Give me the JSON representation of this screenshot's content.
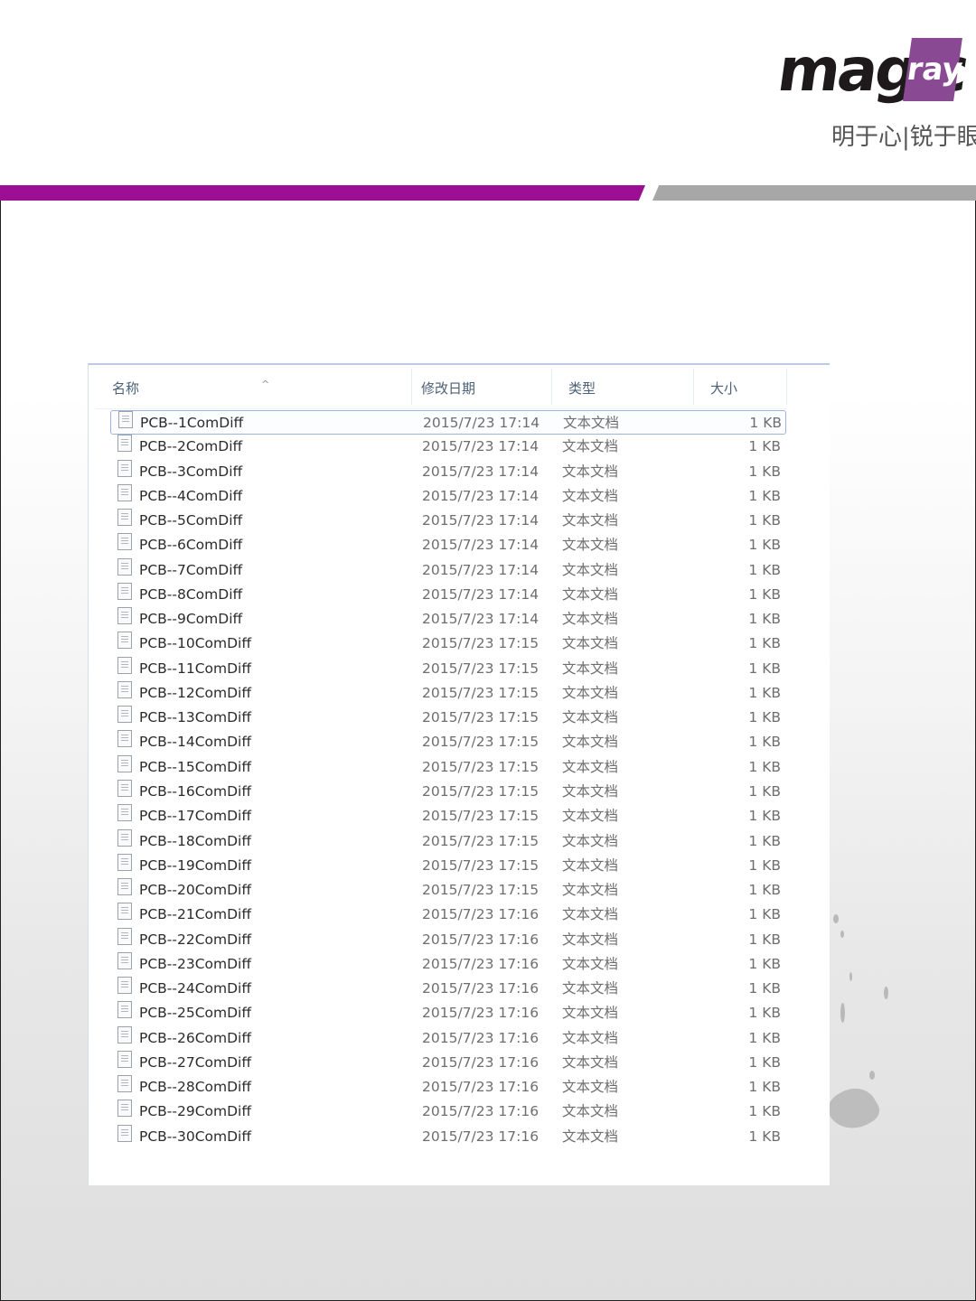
{
  "brand": {
    "logo_main": "magic",
    "logo_accent": "ray",
    "slogan": "明于心|锐于眼",
    "colors": {
      "purple_band": "#9c0f94",
      "gray_band": "#a7a7a7",
      "logo_accent_bg": "#8a4a93"
    }
  },
  "explorer": {
    "columns": {
      "name": "名称",
      "date": "修改日期",
      "type": "类型",
      "size": "大小"
    },
    "sort_indicator": "^",
    "files": [
      {
        "name": "PCB--1ComDiff",
        "date": "2015/7/23 17:14",
        "type": "文本文档",
        "size": "1 KB"
      },
      {
        "name": "PCB--2ComDiff",
        "date": "2015/7/23 17:14",
        "type": "文本文档",
        "size": "1 KB"
      },
      {
        "name": "PCB--3ComDiff",
        "date": "2015/7/23 17:14",
        "type": "文本文档",
        "size": "1 KB"
      },
      {
        "name": "PCB--4ComDiff",
        "date": "2015/7/23 17:14",
        "type": "文本文档",
        "size": "1 KB"
      },
      {
        "name": "PCB--5ComDiff",
        "date": "2015/7/23 17:14",
        "type": "文本文档",
        "size": "1 KB"
      },
      {
        "name": "PCB--6ComDiff",
        "date": "2015/7/23 17:14",
        "type": "文本文档",
        "size": "1 KB"
      },
      {
        "name": "PCB--7ComDiff",
        "date": "2015/7/23 17:14",
        "type": "文本文档",
        "size": "1 KB"
      },
      {
        "name": "PCB--8ComDiff",
        "date": "2015/7/23 17:14",
        "type": "文本文档",
        "size": "1 KB"
      },
      {
        "name": "PCB--9ComDiff",
        "date": "2015/7/23 17:14",
        "type": "文本文档",
        "size": "1 KB"
      },
      {
        "name": "PCB--10ComDiff",
        "date": "2015/7/23 17:15",
        "type": "文本文档",
        "size": "1 KB"
      },
      {
        "name": "PCB--11ComDiff",
        "date": "2015/7/23 17:15",
        "type": "文本文档",
        "size": "1 KB"
      },
      {
        "name": "PCB--12ComDiff",
        "date": "2015/7/23 17:15",
        "type": "文本文档",
        "size": "1 KB"
      },
      {
        "name": "PCB--13ComDiff",
        "date": "2015/7/23 17:15",
        "type": "文本文档",
        "size": "1 KB"
      },
      {
        "name": "PCB--14ComDiff",
        "date": "2015/7/23 17:15",
        "type": "文本文档",
        "size": "1 KB"
      },
      {
        "name": "PCB--15ComDiff",
        "date": "2015/7/23 17:15",
        "type": "文本文档",
        "size": "1 KB"
      },
      {
        "name": "PCB--16ComDiff",
        "date": "2015/7/23 17:15",
        "type": "文本文档",
        "size": "1 KB"
      },
      {
        "name": "PCB--17ComDiff",
        "date": "2015/7/23 17:15",
        "type": "文本文档",
        "size": "1 KB"
      },
      {
        "name": "PCB--18ComDiff",
        "date": "2015/7/23 17:15",
        "type": "文本文档",
        "size": "1 KB"
      },
      {
        "name": "PCB--19ComDiff",
        "date": "2015/7/23 17:15",
        "type": "文本文档",
        "size": "1 KB"
      },
      {
        "name": "PCB--20ComDiff",
        "date": "2015/7/23 17:15",
        "type": "文本文档",
        "size": "1 KB"
      },
      {
        "name": "PCB--21ComDiff",
        "date": "2015/7/23 17:16",
        "type": "文本文档",
        "size": "1 KB"
      },
      {
        "name": "PCB--22ComDiff",
        "date": "2015/7/23 17:16",
        "type": "文本文档",
        "size": "1 KB"
      },
      {
        "name": "PCB--23ComDiff",
        "date": "2015/7/23 17:16",
        "type": "文本文档",
        "size": "1 KB"
      },
      {
        "name": "PCB--24ComDiff",
        "date": "2015/7/23 17:16",
        "type": "文本文档",
        "size": "1 KB"
      },
      {
        "name": "PCB--25ComDiff",
        "date": "2015/7/23 17:16",
        "type": "文本文档",
        "size": "1 KB"
      },
      {
        "name": "PCB--26ComDiff",
        "date": "2015/7/23 17:16",
        "type": "文本文档",
        "size": "1 KB"
      },
      {
        "name": "PCB--27ComDiff",
        "date": "2015/7/23 17:16",
        "type": "文本文档",
        "size": "1 KB"
      },
      {
        "name": "PCB--28ComDiff",
        "date": "2015/7/23 17:16",
        "type": "文本文档",
        "size": "1 KB"
      },
      {
        "name": "PCB--29ComDiff",
        "date": "2015/7/23 17:16",
        "type": "文本文档",
        "size": "1 KB"
      },
      {
        "name": "PCB--30ComDiff",
        "date": "2015/7/23 17:16",
        "type": "文本文档",
        "size": "1 KB"
      }
    ],
    "selected_index": 0,
    "file_icon": "text-document-icon"
  }
}
